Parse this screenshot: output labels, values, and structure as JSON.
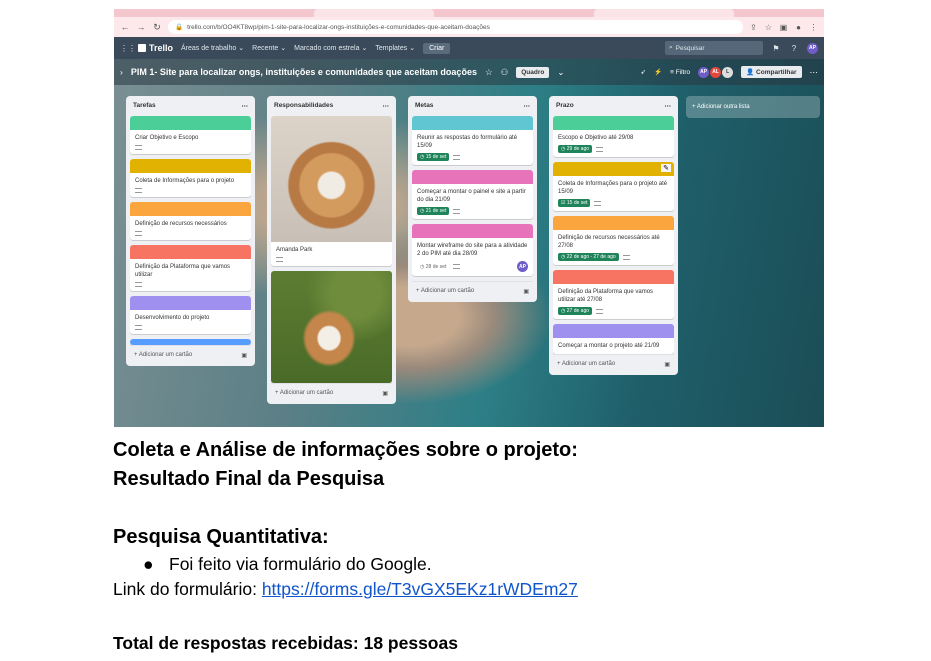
{
  "browser": {
    "url": "trello.com/b/OO4KT8wp/pim-1-site-para-localizar-ongs-instituições-e-comunidades-que-aceitam-doações"
  },
  "trello": {
    "logo": "Trello",
    "menu": [
      "Áreas de trabalho",
      "Recente",
      "Marcado com estrela",
      "Templates"
    ],
    "criar": "Criar",
    "search_placeholder": "Pesquisar",
    "user_initials": "AP",
    "board_title": "PIM 1- Site para localizar ongs, instituições e comunidades que aceitam doações",
    "view_button": "Quadro",
    "filter_label": "Filtro",
    "members": [
      "AP",
      "AL",
      "L"
    ],
    "share_button": "Compartilhar",
    "add_list": "+ Adicionar outra lista",
    "add_card": "+ Adicionar um cartão",
    "lists": {
      "tarefas": {
        "title": "Tarefas",
        "cards": [
          {
            "text": "Criar Objetivo e Escopo",
            "color": "#4bce97"
          },
          {
            "text": "Coleta de Informações para o projeto",
            "color": "#e2b203"
          },
          {
            "text": "Definição de recursos necessários",
            "color": "#faa53d"
          },
          {
            "text": "Definição da Plataforma que vamos utilizar",
            "color": "#f87462"
          },
          {
            "text": "Desenvolvimento do projeto",
            "color": "#9f8fef"
          }
        ]
      },
      "responsabilidades": {
        "title": "Responsabilidades",
        "cards": [
          {
            "text": "Amanda Park"
          }
        ]
      },
      "metas": {
        "title": "Metas",
        "cards": [
          {
            "text": "Reunir as respostas do formulário até 15/09",
            "date": "15 de set",
            "color": "#60c6d2"
          },
          {
            "text": "Começar a montar o painel e site a partir do dia 21/09",
            "date": "21 de set",
            "color": "#e774bb"
          },
          {
            "text": "Montar wireframe do site para a atividade 2 do PIM até dia 28/09",
            "date": "28 de set",
            "color": "#e774bb"
          }
        ]
      },
      "prazo": {
        "title": "Prazo",
        "cards": [
          {
            "text": "Escopo e Objetivo até 29/08",
            "date": "29 de ago",
            "color": "#4bce97"
          },
          {
            "text": "Coleta de Informações para o projeto até 15/09",
            "date": "15 de set",
            "color": "#e2b203"
          },
          {
            "text": "Definição de recursos necessários até 27/08",
            "date": "22 de ago - 27 de ago",
            "color": "#faa53d"
          },
          {
            "text": "Definição da Plataforma que vamos utilizar até 27/08",
            "date": "27 de ago",
            "color": "#f87462"
          },
          {
            "text": "Começar a montar o projeto até 21/09",
            "color": "#9f8fef"
          }
        ]
      }
    }
  },
  "document": {
    "heading_line1": "Coleta e Análise de informações sobre o projeto:",
    "heading_line2": "Resultado Final da Pesquisa",
    "section_title": "Pesquisa Quantitativa:",
    "bullet": "Foi feito via formulário do Google.",
    "link_label": "Link do formulário: ",
    "link_url": "https://forms.gle/T3vGX5EKz1rWDEm27",
    "total": "Total de respostas recebidas: 18 pessoas"
  }
}
